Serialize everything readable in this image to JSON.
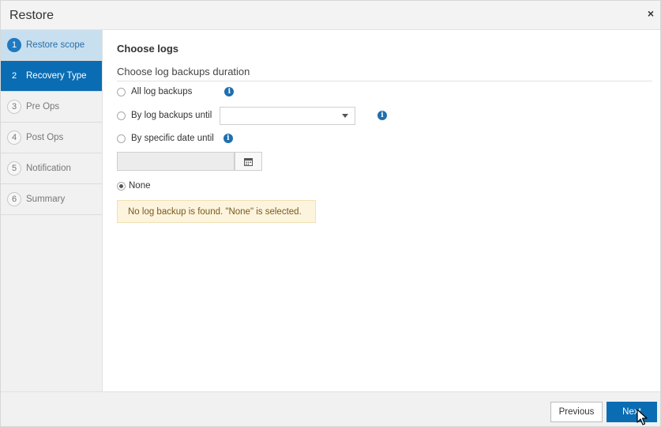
{
  "dialog": {
    "title": "Restore",
    "close_glyph": "×"
  },
  "steps": [
    {
      "num": "1",
      "label": "Restore scope",
      "state": "done"
    },
    {
      "num": "2",
      "label": "Recovery Type",
      "state": "active"
    },
    {
      "num": "3",
      "label": "Pre Ops",
      "state": "pending"
    },
    {
      "num": "4",
      "label": "Post Ops",
      "state": "pending"
    },
    {
      "num": "5",
      "label": "Notification",
      "state": "pending"
    },
    {
      "num": "6",
      "label": "Summary",
      "state": "pending"
    }
  ],
  "content": {
    "heading": "Choose logs",
    "subheading": "Choose log backups duration",
    "options": {
      "all_log_backups": "All log backups",
      "by_log_backups_until": "By log backups until",
      "by_specific_date_until": "By specific date until",
      "none": "None"
    },
    "selected_option": "none",
    "log_backup_select_value": "",
    "date_value": "",
    "info_glyph": "i",
    "alert_text": "No log backup is found. \"None\" is selected."
  },
  "footer": {
    "previous_label": "Previous",
    "next_label": "Next"
  },
  "colors": {
    "accent": "#0a6db3",
    "step_done_bg": "#c8dff0",
    "alert_bg": "#fcf4dd"
  },
  "icons": [
    "close-icon",
    "info-icon",
    "dropdown-caret-icon",
    "calendar-icon",
    "mouse-pointer-icon"
  ]
}
